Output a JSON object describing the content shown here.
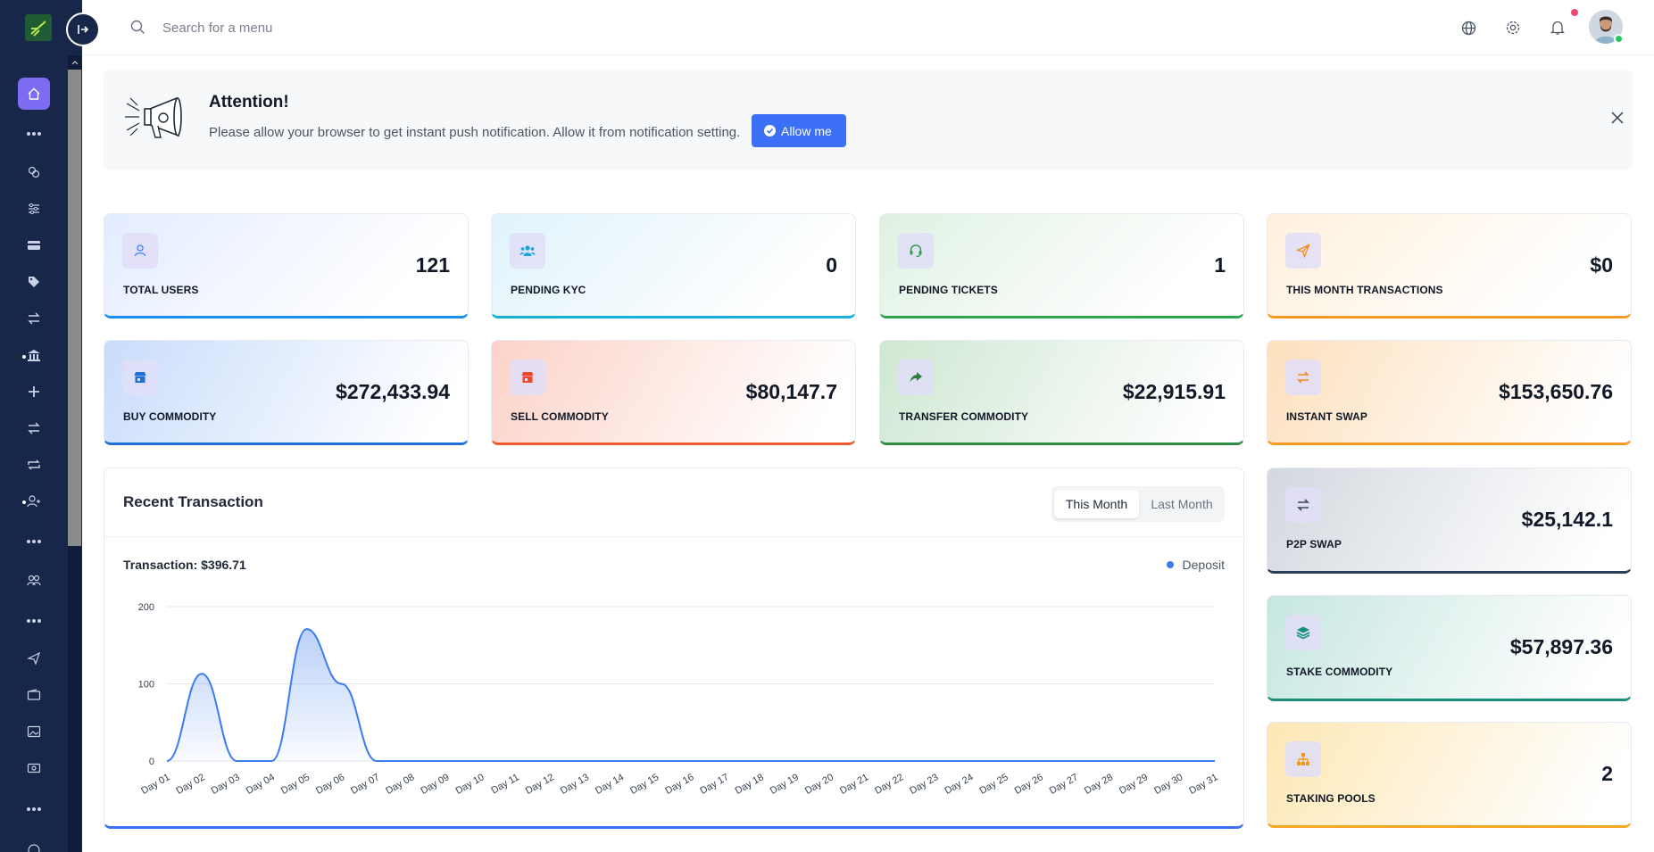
{
  "header": {
    "search_placeholder": "Search for a menu",
    "icons": [
      "search-icon",
      "globe-icon",
      "gear-icon",
      "bell-icon",
      "avatar"
    ]
  },
  "banner": {
    "title": "Attention!",
    "text": "Please allow your browser to get instant push notification. Allow it from notification setting.",
    "button": "Allow me"
  },
  "cards": [
    {
      "label": "TOTAL USERS",
      "value": "121",
      "icon": "user-icon"
    },
    {
      "label": "PENDING KYC",
      "value": "0",
      "icon": "users-icon"
    },
    {
      "label": "PENDING TICKETS",
      "value": "1",
      "icon": "headset-icon"
    },
    {
      "label": "THIS MONTH TRANSACTIONS",
      "value": "$0",
      "icon": "paper-plane-icon"
    },
    {
      "label": "BUY COMMODITY",
      "value": "$272,433.94",
      "icon": "store-icon"
    },
    {
      "label": "SELL COMMODITY",
      "value": "$80,147.7",
      "icon": "store-icon"
    },
    {
      "label": "TRANSFER COMMODITY",
      "value": "$22,915.91",
      "icon": "share-arrow-icon"
    },
    {
      "label": "INSTANT SWAP",
      "value": "$153,650.76",
      "icon": "swap-icon"
    },
    {
      "label": "P2P SWAP",
      "value": "$25,142.1",
      "icon": "swap-icon"
    },
    {
      "label": "STAKE COMMODITY",
      "value": "$57,897.36",
      "icon": "layers-icon"
    },
    {
      "label": "STAKING POOLS",
      "value": "2",
      "icon": "sitemap-icon"
    }
  ],
  "panel": {
    "title": "Recent Transaction",
    "tabs": [
      "This Month",
      "Last Month"
    ],
    "active_tab": "This Month",
    "transaction_label": "Transaction: $396.71",
    "legend": "Deposit"
  },
  "chart_data": {
    "type": "area",
    "x": [
      "Day 01",
      "Day 02",
      "Day 03",
      "Day 04",
      "Day 05",
      "Day 06",
      "Day 07",
      "Day 08",
      "Day 09",
      "Day 10",
      "Day 11",
      "Day 12",
      "Day 13",
      "Day 14",
      "Day 15",
      "Day 16",
      "Day 17",
      "Day 18",
      "Day 19",
      "Day 20",
      "Day 21",
      "Day 22",
      "Day 23",
      "Day 24",
      "Day 25",
      "Day 26",
      "Day 27",
      "Day 28",
      "Day 29",
      "Day 30",
      "Day 31"
    ],
    "series": [
      {
        "name": "Deposit",
        "values": [
          0,
          113,
          0,
          0,
          171,
          100,
          0,
          0,
          0,
          0,
          0,
          0,
          0,
          0,
          0,
          0,
          0,
          0,
          0,
          0,
          0,
          0,
          0,
          0,
          0,
          0,
          0,
          0,
          0,
          0,
          0
        ]
      }
    ],
    "yticks": [
      0,
      100,
      200
    ],
    "ylim": [
      0,
      200
    ],
    "legend": "top-right",
    "grid": true,
    "color": "#3b7bf0"
  }
}
